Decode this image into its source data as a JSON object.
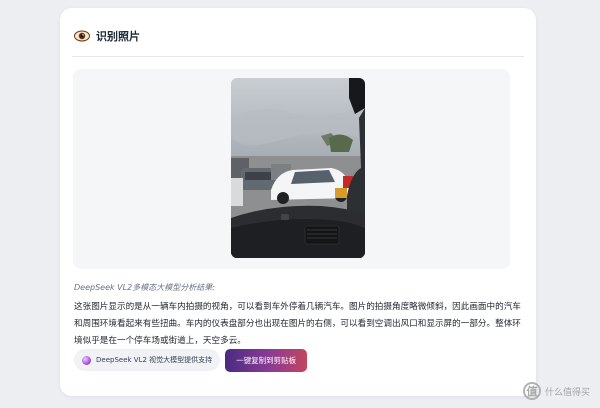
{
  "card": {
    "title": "识别照片",
    "caption": "DeepSeek VL2多模态大模型分析结果:",
    "description": "这张图片显示的是从一辆车内拍摄的视角，可以看到车外停着几辆汽车。图片的拍摄角度略微倾斜，因此画面中的汽车和周围环境看起来有些扭曲。车内的仪表盘部分也出现在图片的右侧，可以看到空调出风口和显示屏的一部分。整体环境似乎是在一个停车场或街道上，天空多云。",
    "model_badge": "DeepSeek VL2 视觉大模型提供支持",
    "copy_button": "一键复制到剪贴板"
  },
  "watermark": {
    "glyph": "值",
    "text": "什么值得买"
  },
  "colors": {
    "accent_start": "#4a2b82",
    "accent_end": "#c4455f"
  }
}
